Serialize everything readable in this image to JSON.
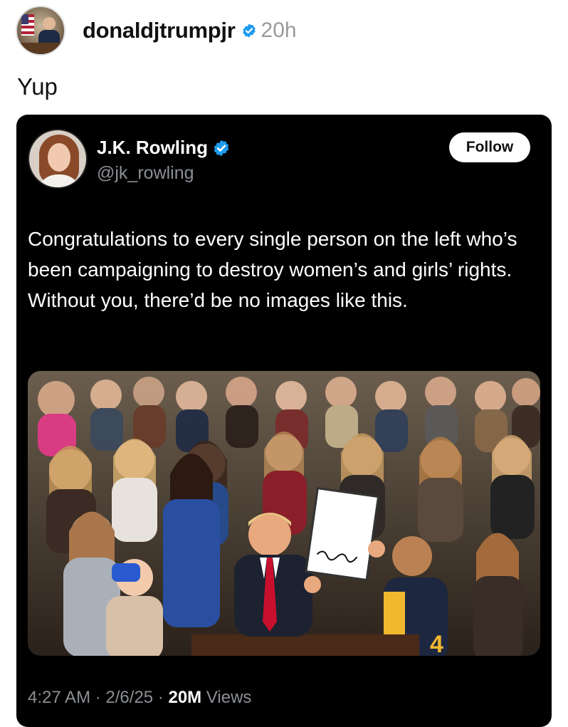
{
  "post": {
    "username": "donaldjtrumpjr",
    "time_ago": "20h",
    "caption": "Yup"
  },
  "embed": {
    "name": "J.K. Rowling",
    "handle": "@jk_rowling",
    "follow_label": "Follow",
    "text": "Congratulations to every single person on the left who’s been campaigning to destroy women’s and girls’ rights. Without you, there’d be no images like this.",
    "time": "4:27 AM",
    "date": "2/6/25",
    "views_count": "20M",
    "views_label": "Views"
  },
  "icons": {
    "verified": "verified-badge-icon"
  },
  "colors": {
    "verified_blue": "#1d9bf0",
    "embed_bg": "#000000",
    "muted_text": "#8b8f94"
  }
}
